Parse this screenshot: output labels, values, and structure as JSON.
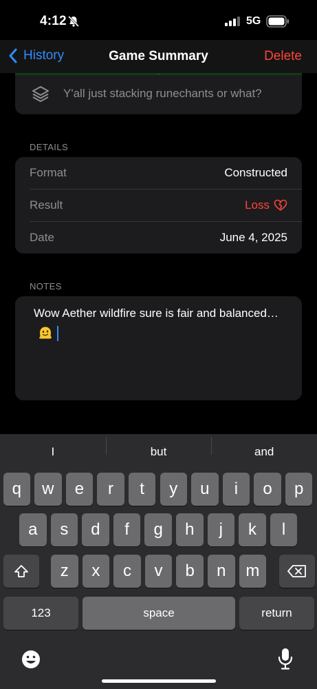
{
  "status": {
    "time": "4:12",
    "network": "5G"
  },
  "nav": {
    "back_label": "History",
    "title": "Game Summary",
    "delete_label": "Delete"
  },
  "previous_entry": {
    "comment": "Y'all just stacking runechants or what?"
  },
  "details": {
    "header": "DETAILS",
    "rows": [
      {
        "label": "Format",
        "value": "Constructed"
      },
      {
        "label": "Result",
        "value": "Loss"
      },
      {
        "label": "Date",
        "value": "June 4, 2025"
      }
    ]
  },
  "notes": {
    "header": "NOTES",
    "text": "Wow Aether wildfire sure is fair and balanced…",
    "emoji": "melting-face"
  },
  "keyboard": {
    "suggestions": [
      "I",
      "but",
      "and"
    ],
    "row1": [
      "q",
      "w",
      "e",
      "r",
      "t",
      "y",
      "u",
      "i",
      "o",
      "p"
    ],
    "row2": [
      "a",
      "s",
      "d",
      "f",
      "g",
      "h",
      "j",
      "k",
      "l"
    ],
    "row3": [
      "z",
      "x",
      "c",
      "v",
      "b",
      "n",
      "m"
    ],
    "numbers_label": "123",
    "space_label": "space",
    "return_label": "return"
  },
  "colors": {
    "accent": "#2f8cff",
    "destructive": "#ff453a",
    "card": "#1c1c1e",
    "keyboard": "#2c2c2e"
  }
}
